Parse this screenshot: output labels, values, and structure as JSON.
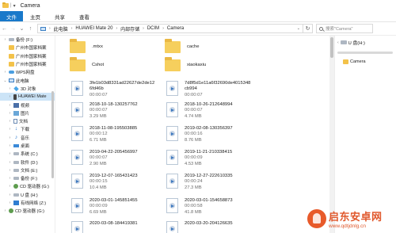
{
  "window": {
    "title": "Camera"
  },
  "ribbon": {
    "tabs": [
      {
        "label": "文件",
        "active": true
      },
      {
        "label": "主页",
        "active": false
      },
      {
        "label": "共享",
        "active": false
      },
      {
        "label": "查看",
        "active": false
      }
    ]
  },
  "address": {
    "crumbs": [
      "此电脑",
      "HUAWEI Mate 20",
      "内部存储",
      "DCIM",
      "Camera"
    ],
    "search_placeholder": "搜索\"Camera\""
  },
  "sidebar": {
    "items": [
      {
        "label": "备份 (F:)",
        "icon": "drive-icon",
        "child": false
      },
      {
        "label": "广州市国家档案",
        "icon": "folder-icon",
        "child": false
      },
      {
        "label": "广州市国家档案",
        "icon": "folder-icon",
        "child": false
      },
      {
        "label": "广州市国家档案",
        "icon": "folder-icon",
        "child": false
      },
      {
        "label": "WPS网盘",
        "icon": "cloud-icon",
        "child": false
      },
      {
        "label": "此电脑",
        "icon": "computer-icon",
        "child": false
      },
      {
        "label": "3D 对象",
        "icon": "3d-objects-icon",
        "child": true
      },
      {
        "label": "HUAWEI Mate",
        "icon": "phone-icon",
        "child": true,
        "selected": true
      },
      {
        "label": "视频",
        "icon": "video-icon",
        "child": true
      },
      {
        "label": "图片",
        "icon": "pictures-icon",
        "child": true
      },
      {
        "label": "文档",
        "icon": "document-icon",
        "child": true
      },
      {
        "label": "下载",
        "icon": "download-icon",
        "child": true
      },
      {
        "label": "音乐",
        "icon": "music-icon",
        "child": true
      },
      {
        "label": "桌面",
        "icon": "desktop-icon",
        "child": true
      },
      {
        "label": "系统 (C:)",
        "icon": "drive-icon",
        "child": true
      },
      {
        "label": "软件 (D:)",
        "icon": "drive-icon",
        "child": true
      },
      {
        "label": "文档 (E:)",
        "icon": "drive-icon",
        "child": true
      },
      {
        "label": "备份 (F:)",
        "icon": "drive-icon",
        "child": true
      },
      {
        "label": "CD 驱动器 (G:)",
        "icon": "dvd-icon",
        "child": true
      },
      {
        "label": "U 盘 (H:)",
        "icon": "usb-drive-icon",
        "child": true
      },
      {
        "label": "有线网络 (Z:)",
        "icon": "network-drive-icon",
        "child": true
      },
      {
        "label": "CD 驱动器 (G:)",
        "icon": "dvd-icon",
        "child": false
      }
    ]
  },
  "files": {
    "left": [
      {
        "type": "folder",
        "name": ".mtxx",
        "shortcut": false
      },
      {
        "type": "folder",
        "name": "Cshot",
        "shortcut": false
      },
      {
        "type": "media",
        "name": "3fe1b03d8331ad22627de2de12",
        "name2": "6fd46b",
        "duration": "00:00:07",
        "size": ""
      },
      {
        "type": "media",
        "name": "2018-10-18-130257762",
        "duration": "00:00:07",
        "size": "3.29 MB"
      },
      {
        "type": "media",
        "name": "2018-11-08-195503885",
        "duration": "00:00:12",
        "size": "6.71 MB"
      },
      {
        "type": "media",
        "name": "2019-04-22-205456997",
        "duration": "00:00:07",
        "size": "2.90 MB"
      },
      {
        "type": "media",
        "name": "2019-12-07-165431423",
        "duration": "00:00:15",
        "size": "10.4 MB"
      },
      {
        "type": "media",
        "name": "2020-03-01-145851455",
        "duration": "00:00:09",
        "size": "6.69 MB"
      },
      {
        "type": "media",
        "name": "2020-03-08-184419381",
        "duration": "",
        "size": ""
      }
    ],
    "right": [
      {
        "type": "folder",
        "name": "cache",
        "shortcut": false
      },
      {
        "type": "folder",
        "name": "xiaokaxiu",
        "shortcut": false
      },
      {
        "type": "media",
        "name": "7d8f5d1e11a6f32690de4015348",
        "name2": "cb994",
        "duration": "00:00:07",
        "size": ""
      },
      {
        "type": "media",
        "name": "2018-10-26-212648994",
        "duration": "00:00:07",
        "size": "4.74 MB"
      },
      {
        "type": "media",
        "name": "2019-02-08-130356397",
        "duration": "00:00:16",
        "size": "8.76 MB"
      },
      {
        "type": "media",
        "name": "2019-11-21-210338415",
        "duration": "00:00:09",
        "size": "4.53 MB"
      },
      {
        "type": "media",
        "name": "2019-12-27-222610335",
        "duration": "00:00:24",
        "size": "27.3 MB"
      },
      {
        "type": "media",
        "name": "2020-03-01-154658873",
        "duration": "00:00:58",
        "size": "41.8 MB"
      },
      {
        "type": "media",
        "name": "2020-03-20-204126635",
        "duration": "",
        "size": ""
      }
    ]
  },
  "right_pane": {
    "drive_label": "U 盘(H:)",
    "selected_folder": "Camera"
  },
  "watermark": {
    "cn": "启东安卓网",
    "url": "www.qdtjdnlg.cn"
  }
}
